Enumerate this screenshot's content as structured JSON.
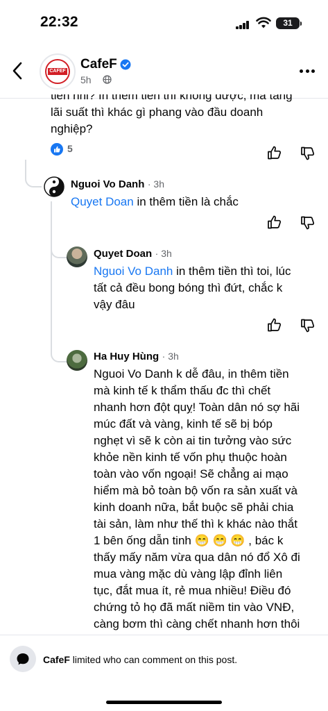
{
  "status": {
    "time": "22:32",
    "battery": "31"
  },
  "header": {
    "page_name": "CafeF",
    "logo_text": "CAFEF",
    "age": "5h"
  },
  "top_comment": {
    "lines": [
      "tiền nhỉ? In thêm tiền thì không được, mà tăng",
      "lãi suất thì khác gì phang vào đầu doanh",
      "nghiệp?"
    ],
    "reaction_count": "5"
  },
  "comments": [
    {
      "author": "Nguoi Vo Danh",
      "time": "3h",
      "mention": "Quyet Doan",
      "lines": [
        " in thêm tiền là chắc"
      ]
    },
    {
      "author": "Quyet Doan",
      "time": "3h",
      "mention": "Nguoi Vo Danh",
      "lines": [
        " in thêm tiền thì toi, lúc",
        "tất cả đều bong bóng thì đứt, chắc k",
        "vậy đâu"
      ]
    },
    {
      "author": "Ha Huy Hùng",
      "time": "3h",
      "lines": [
        "Nguoi Vo Danh k dễ đâu, in thêm tiền",
        "mà kinh tế k thẩm thấu đc thì chết",
        "nhanh hơn đột quỵ! Toàn dân nó sợ hãi",
        "múc đất và vàng, kinh tế sẽ bị bóp",
        "nghẹt vì sẽ k còn ai tin tưởng vào sức",
        "khỏe nền kinh tế vốn phụ thuộc hoàn",
        "toàn vào vốn ngoại! Sẽ chẳng ai mạo",
        "hiểm mà bỏ toàn bộ vốn ra sản xuất và",
        "kinh doanh nữa, bắt buộc sẽ phải chia",
        "tài sản, làm như thế thì k khác nào thắt",
        "1 bên ống dẫn tinh 😁 😁 😁 , bác k",
        "thấy mấy năm vừa qua dân nó đổ Xô đi",
        "mua vàng mặc dù vàng lập đỉnh liên",
        "tục, đắt mua ít, rẻ mua nhiều! Điều đó",
        "chứng tỏ họ đã mất niềm tin vào VNĐ,",
        "càng bơm thì càng chết nhanh hơn thôi"
      ]
    }
  ],
  "footer": {
    "page_name": "CafeF",
    "notice": " limited who can comment on this post."
  },
  "icons": {
    "like": "thumbs-up-icon",
    "dislike": "thumbs-down-icon",
    "back": "chevron-left-icon",
    "more": "more-horizontal-icon"
  }
}
